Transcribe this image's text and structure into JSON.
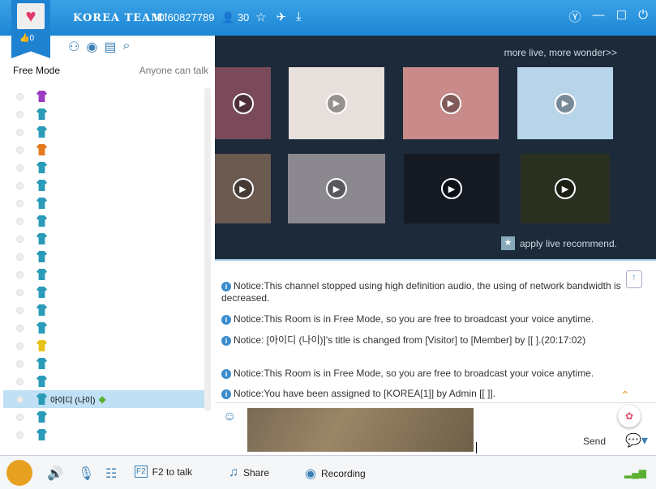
{
  "header": {
    "room_name": "KOREA TEAM!",
    "room_id": "ID 60827789",
    "user_count": "30",
    "likes": "0"
  },
  "left": {
    "mode": "Free Mode",
    "talk_policy": "Anyone can talk",
    "users": [
      {
        "color": "#9b3cc0",
        "name": ""
      },
      {
        "color": "#2a9bb8",
        "name": ""
      },
      {
        "color": "#2a9bb8",
        "name": ""
      },
      {
        "color": "#e47a1e",
        "name": ""
      },
      {
        "color": "#2a9bb8",
        "name": ""
      },
      {
        "color": "#2a9bb8",
        "name": ""
      },
      {
        "color": "#2a9bb8",
        "name": ""
      },
      {
        "color": "#2a9bb8",
        "name": ""
      },
      {
        "color": "#2a9bb8",
        "name": ""
      },
      {
        "color": "#2a9bb8",
        "name": ""
      },
      {
        "color": "#2a9bb8",
        "name": ""
      },
      {
        "color": "#2a9bb8",
        "name": ""
      },
      {
        "color": "#2a9bb8",
        "name": ""
      },
      {
        "color": "#2a9bb8",
        "name": ""
      },
      {
        "color": "#e8c21a",
        "name": ""
      },
      {
        "color": "#2a9bb8",
        "name": ""
      },
      {
        "color": "#2a9bb8",
        "name": ""
      },
      {
        "color": "#2a9bb8",
        "name": "아이디 (나이)",
        "selected": true
      },
      {
        "color": "#2a9bb8",
        "name": ""
      },
      {
        "color": "#2a9bb8",
        "name": ""
      }
    ]
  },
  "media": {
    "more_link": "more live, more wonder>>",
    "apply_label": "apply live recommend."
  },
  "chat": {
    "messages": [
      "Notice:This channel stopped using high definition audio, the using of network bandwidth is decreased.",
      "Notice:This Room is in Free Mode, so you are free to broadcast your voice anytime.",
      "Notice: [아이디 (나이)]'s title is changed from [Visitor] to [Member] by [[                                        ].(20:17:02)",
      "Notice:This Room is in Free Mode, so you are free to broadcast your voice anytime.",
      "Notice:You have been assigned to [KOREA[1]] by Admin [[                                    ]]."
    ]
  },
  "input": {
    "send_label": "Send"
  },
  "bottom": {
    "f2": "F2 to talk",
    "share": "Share",
    "recording": "Recording",
    "f2_key": "F2"
  }
}
